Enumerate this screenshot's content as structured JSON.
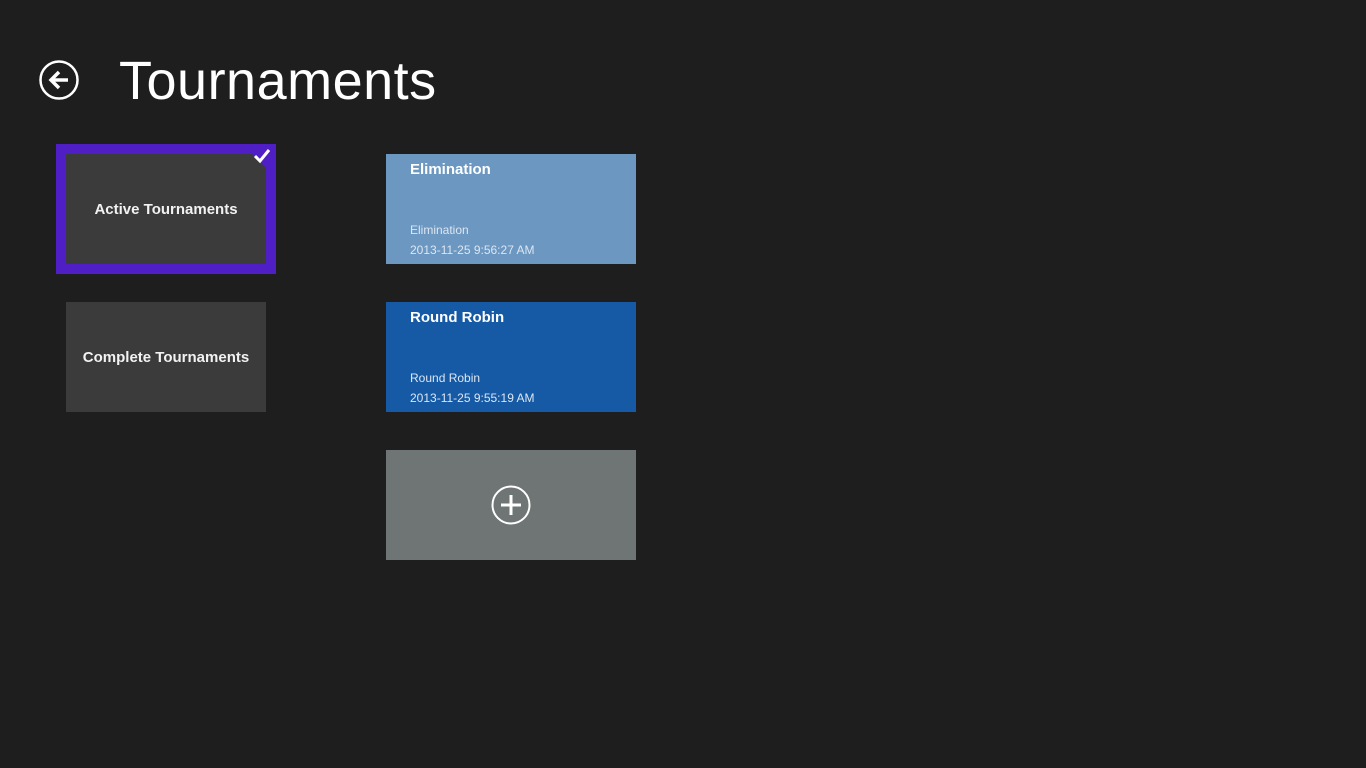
{
  "header": {
    "title": "Tournaments",
    "back_icon": "back-arrow-icon"
  },
  "categories": [
    {
      "label": "Active Tournaments",
      "selected": true
    },
    {
      "label": "Complete Tournaments",
      "selected": false
    }
  ],
  "tournaments": [
    {
      "name": "Elimination",
      "type": "Elimination",
      "date": "2013-11-25 9:56:27 AM",
      "color": "#6b97c1"
    },
    {
      "name": "Round Robin",
      "type": "Round Robin",
      "date": "2013-11-25 9:55:19 AM",
      "color": "#165aa5"
    }
  ],
  "add_tile": {
    "icon": "add-icon",
    "color": "#6e7574"
  },
  "colors": {
    "background": "#1e1e1e",
    "selection": "#4f1ec4",
    "category_tile": "#3b3b3b"
  }
}
